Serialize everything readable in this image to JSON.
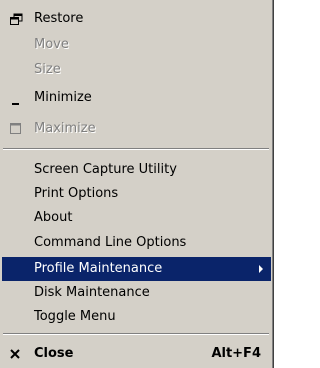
{
  "menu": {
    "system_items": [
      {
        "label": "Restore",
        "icon": "restore-icon",
        "enabled": true
      },
      {
        "label": "Move",
        "enabled": false
      },
      {
        "label": "Size",
        "enabled": false
      },
      {
        "label": "Minimize",
        "icon": "minimize-icon",
        "enabled": true
      },
      {
        "label": "Maximize",
        "icon": "maximize-icon",
        "enabled": false
      }
    ],
    "custom_items": [
      {
        "label": "Screen Capture Utility"
      },
      {
        "label": "Print Options"
      },
      {
        "label": "About"
      },
      {
        "label": "Command Line Options"
      },
      {
        "label": "Profile Maintenance",
        "selected": true,
        "has_submenu": true
      },
      {
        "label": "Disk Maintenance"
      },
      {
        "label": "Toggle Menu"
      }
    ],
    "close_item": {
      "label": "Close",
      "shortcut": "Alt+F4",
      "icon": "close-icon"
    }
  },
  "colors": {
    "menu_background": "#d4d0c8",
    "selection_background": "#0a246a",
    "disabled_text": "#808080",
    "pointer_arrow": "#e00000"
  }
}
